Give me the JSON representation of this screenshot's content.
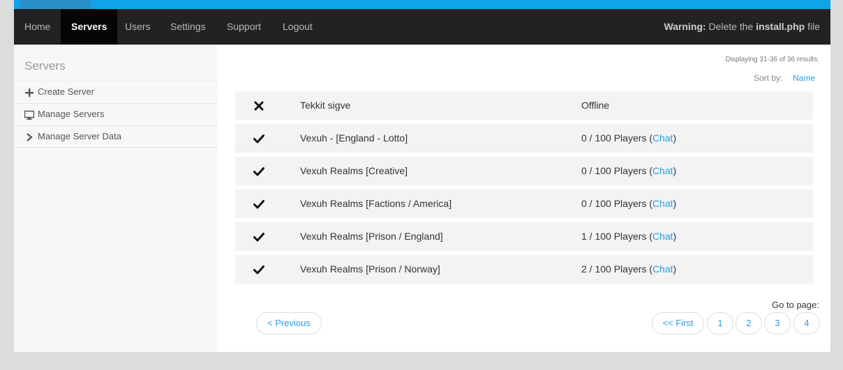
{
  "nav": {
    "items": [
      {
        "label": "Home"
      },
      {
        "label": "Servers"
      },
      {
        "label": "Users"
      },
      {
        "label": "Settings"
      },
      {
        "label": "Support"
      },
      {
        "label": "Logout"
      }
    ],
    "active_index": 1,
    "warning": {
      "prefix": "Warning:",
      "text1": " Delete the ",
      "file": "install.php",
      "text2": " file"
    }
  },
  "sidebar": {
    "title": "Servers",
    "items": [
      {
        "label": "Create Server",
        "icon": "plus-icon"
      },
      {
        "label": "Manage Servers",
        "icon": "monitor-icon"
      },
      {
        "label": "Manage Server Data",
        "icon": "chevron-right-icon"
      }
    ]
  },
  "main": {
    "results_info": "Displaying 31-36 of 36 results.",
    "sort_label": "Sort by:",
    "sort_value": "Name",
    "servers": [
      {
        "online": false,
        "status_icon": "cross-icon",
        "name": "Tekkit sigve",
        "status": "Offline",
        "chat": null
      },
      {
        "online": true,
        "status_icon": "check-icon",
        "name": "Vexuh - [England - Lotto]",
        "status": "0 / 100 Players (",
        "chat": "Chat",
        "close": ")"
      },
      {
        "online": true,
        "status_icon": "check-icon",
        "name": "Vexuh Realms [Creative]",
        "status": "0 / 100 Players (",
        "chat": "Chat",
        "close": ")"
      },
      {
        "online": true,
        "status_icon": "check-icon",
        "name": "Vexuh Realms [Factions / America]",
        "status": "0 / 100 Players (",
        "chat": "Chat",
        "close": ")"
      },
      {
        "online": true,
        "status_icon": "check-icon",
        "name": "Vexuh Realms [Prison / England]",
        "status": "1 / 100 Players (",
        "chat": "Chat",
        "close": ")"
      },
      {
        "online": true,
        "status_icon": "check-icon",
        "name": "Vexuh Realms [Prison / Norway]",
        "status": "2 / 100 Players (",
        "chat": "Chat",
        "close": ")"
      }
    ],
    "pagination": {
      "goto_label": "Go to page:",
      "previous": "< Previous",
      "first": "<< First",
      "pages": [
        "1",
        "2",
        "3",
        "4"
      ]
    }
  },
  "colors": {
    "accent": "#0fa3e8",
    "link": "#2b9be0",
    "nav_bg": "#222222"
  }
}
